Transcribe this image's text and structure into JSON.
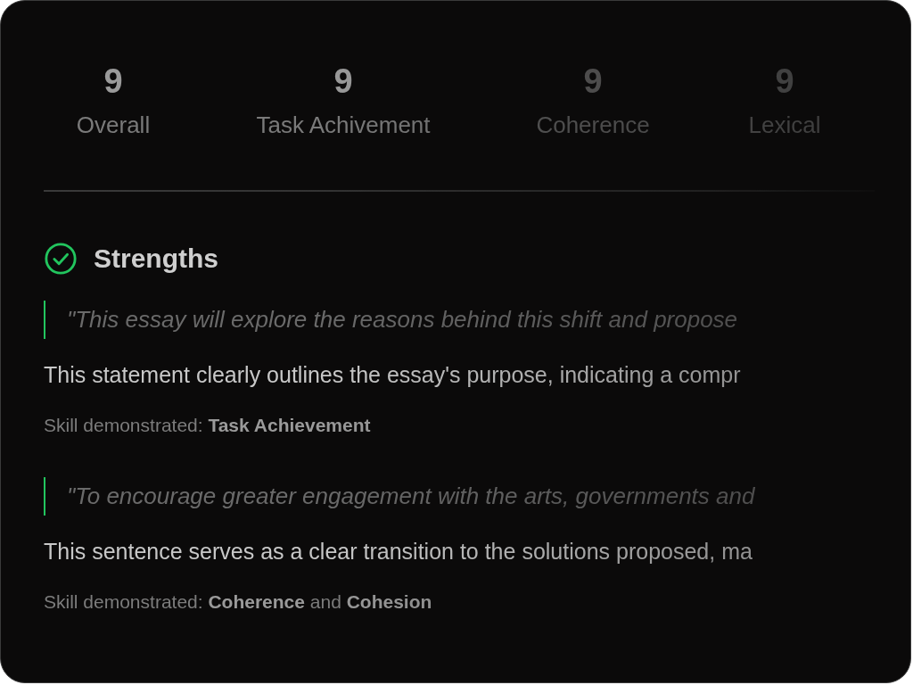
{
  "scores": [
    {
      "value": "9",
      "label": "Overall"
    },
    {
      "value": "9",
      "label": "Task Achivement"
    },
    {
      "value": "9",
      "label": "Coherence"
    },
    {
      "value": "9",
      "label": "Lexical"
    }
  ],
  "strengths": {
    "title": "Strengths",
    "items": [
      {
        "quote": "\"This essay will explore the reasons behind this shift and propose",
        "explanation": "This statement clearly outlines the essay's purpose, indicating a compr",
        "skill": "Skill demonstrated: **Task Achievement**"
      },
      {
        "quote": "\"To encourage greater engagement with the arts, governments and",
        "explanation": "This sentence serves as a clear transition to the solutions proposed, ma",
        "skill": "Skill demonstrated: **Coherence** and **Cohesion**"
      }
    ]
  }
}
